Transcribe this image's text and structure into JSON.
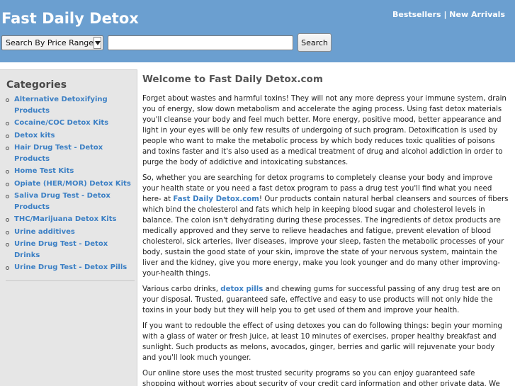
{
  "header": {
    "site_title": "Fast Daily Detox",
    "links": {
      "bestsellers": "Bestsellers",
      "separator": " | ",
      "new_arrivals": "New Arrivals"
    },
    "search": {
      "select_label": "Search By Price Range",
      "input_value": "",
      "button_label": "Search"
    }
  },
  "sidebar": {
    "title": "Categories",
    "items": [
      "Alternative Detoxifying Products",
      "Cocaine/COC Detox Kits",
      "Detox kits",
      "Hair Drug Test - Detox Products",
      "Home Test Kits",
      "Opiate (HER/MOR) Detox Kits",
      "Saliva Drug Test - Detox Products",
      "THC/Marijuana Detox Kits",
      "Urine additives",
      "Urine Drug Test - Detox Drinks",
      "Urine Drug Test - Detox Pills"
    ]
  },
  "main": {
    "heading": "Welcome to Fast Daily Detox.com",
    "p1": "Forget about wastes and harmful toxins! They will not any more depress your immune system, drain you of energy, slow down metabolism and accelerate the aging process. Using fast detox materials you'll cleanse your body and feel much better. More energy, positive mood, better appearance and light in your eyes will be only few results of undergoing of such program. Detoxification is used by people who want to make the metabolic process by which body reduces toxic qualities of poisons and toxins faster and it's also used as a medical treatment of drug and alcohol addiction in order to purge the body of addictive and intoxicating substances.",
    "p2_before": "So, whether you are searching for detox programs to completely cleanse your body and improve your health state or you need a fast detox program to pass a drug test you'll find what you need here- at ",
    "p2_link": "Fast Daily Detox.com",
    "p2_after": "! Our products contain natural herbal cleansers and sources of fibers which bind the cholesterol and fats which help in keeping blood sugar and cholesterol levels in balance. The colon isn't dehydrating during these processes. The ingredients of detox products are medically approved and they serve to relieve headaches and fatigue, prevent elevation of blood cholesterol, sick arteries, liver diseases, improve your sleep, fasten the metabolic processes of your body, sustain the good state of your skin, improve the state of your nervous system, maintain the liver and the kidney, give you more energy, make you look younger and do many other improving-your-health things.",
    "p3_before": "Various carbo drinks, ",
    "p3_link": "detox pills",
    "p3_after": " and chewing gums for successful passing of any drug test are on your disposal. Trusted, guaranteed safe, effective and easy to use products will not only hide the toxins in your body but they will help you to get used of them and improve your health.",
    "p4": "If you want to redouble the effect of using detoxes you can do following things: begin your morning with a glass of water or fresh juice, at least 10 minutes of exercises, proper healthy breakfast and sunlight. Such products as melons, avocados, ginger, berries and garlic will rejuvenate your body and you'll look much younger.",
    "p5": "Our online store uses the most trusted security programs so you can enjoy guaranteed safe shopping without worries about security of your credit card information and other private data. We provide you with good customer service and only high quality products at low prices."
  },
  "colors": {
    "header_bg": "#6b9fd0",
    "link": "#3b7fc4",
    "sidebar_bg": "#e6e6e6"
  },
  "icons": {
    "select_arrow": "chevron-down-icon",
    "list_bullet": "circle-bullet-icon"
  }
}
